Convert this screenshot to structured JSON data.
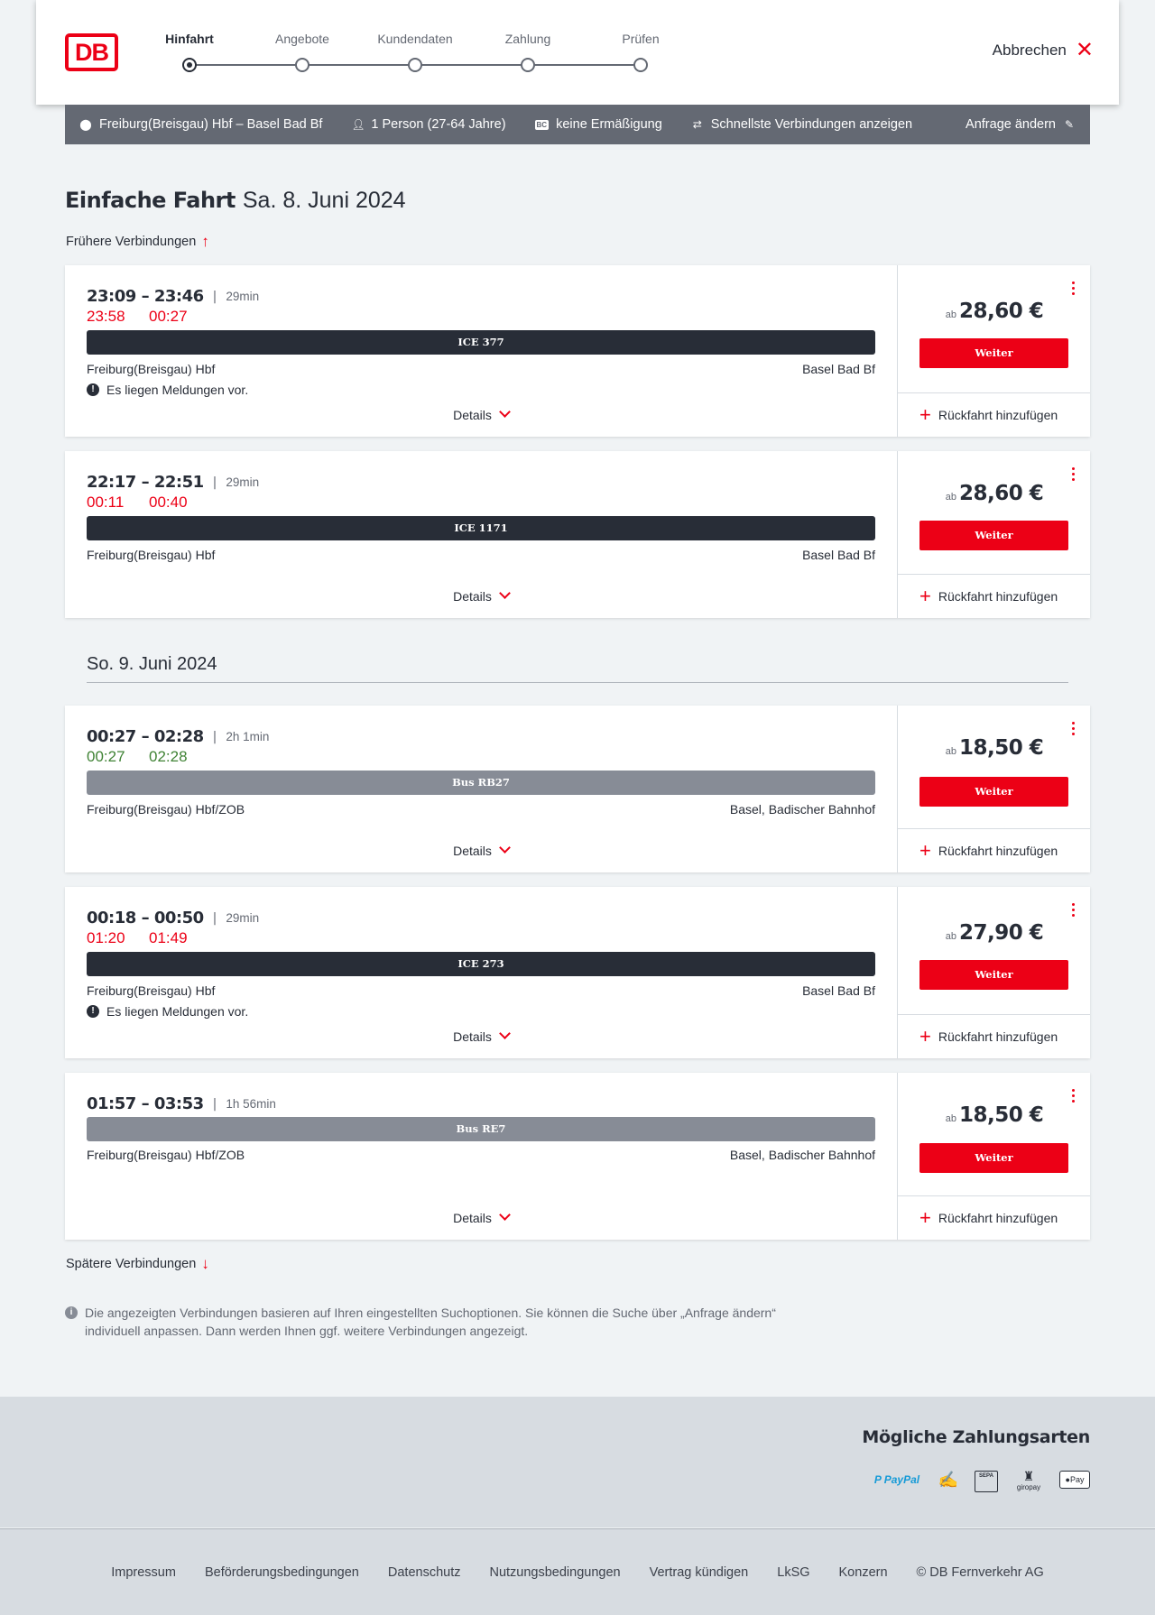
{
  "header": {
    "logo": "DB",
    "steps": [
      {
        "label": "Hinfahrt",
        "active": true
      },
      {
        "label": "Angebote",
        "active": false
      },
      {
        "label": "Kundendaten",
        "active": false
      },
      {
        "label": "Zahlung",
        "active": false
      },
      {
        "label": "Prüfen",
        "active": false
      }
    ],
    "cancel_label": "Abbrechen"
  },
  "query": {
    "route": "Freiburg(Breisgau) Hbf – Basel Bad Bf",
    "persons": "1 Person (27-64 Jahre)",
    "discount_badge": "BC",
    "discount": "keine Ermäßigung",
    "option": "Schnellste Verbindungen anzeigen",
    "edit": "Anfrage ändern"
  },
  "title": {
    "main": "Einfache Fahrt",
    "date": "Sa. 8. Juni 2024"
  },
  "earlier": "Frühere Verbindungen",
  "later": "Spätere Verbindungen",
  "day2": "So. 9. Juni 2024",
  "labels": {
    "details": "Details",
    "ab": "ab",
    "weiter": "Weiter",
    "return": "Rückfahrt hinzufügen",
    "message": "Es liegen Meldungen vor."
  },
  "connections": [
    {
      "times": "23:09 – 23:46",
      "duration": "29min",
      "rt_dep": "23:58",
      "rt_arr": "00:27",
      "rt_status": "red",
      "train": "ICE 377",
      "train_style": "dark",
      "from": "Freiburg(Breisgau) Hbf",
      "to": "Basel Bad Bf",
      "message": true,
      "price": "28,60 €"
    },
    {
      "times": "22:17 – 22:51",
      "duration": "29min",
      "rt_dep": "00:11",
      "rt_arr": "00:40",
      "rt_status": "red",
      "train": "ICE 1171",
      "train_style": "dark",
      "from": "Freiburg(Breisgau) Hbf",
      "to": "Basel Bad Bf",
      "message": false,
      "price": "28,60 €"
    },
    {
      "times": "00:27 – 02:28",
      "duration": "2h 1min",
      "rt_dep": "00:27",
      "rt_arr": "02:28",
      "rt_status": "green",
      "train": "Bus RB27",
      "train_style": "grey",
      "from": "Freiburg(Breisgau) Hbf/ZOB",
      "to": "Basel, Badischer Bahnhof",
      "message": false,
      "price": "18,50 €"
    },
    {
      "times": "00:18 – 00:50",
      "duration": "29min",
      "rt_dep": "01:20",
      "rt_arr": "01:49",
      "rt_status": "red",
      "train": "ICE 273",
      "train_style": "dark",
      "from": "Freiburg(Breisgau) Hbf",
      "to": "Basel Bad Bf",
      "message": true,
      "price": "27,90 €"
    },
    {
      "times": "01:57 – 03:53",
      "duration": "1h 56min",
      "rt_dep": "",
      "rt_arr": "",
      "rt_status": "none",
      "train": "Bus RE7",
      "train_style": "grey",
      "from": "Freiburg(Breisgau) Hbf/ZOB",
      "to": "Basel, Badischer Bahnhof",
      "message": false,
      "price": "18,50 €"
    }
  ],
  "info": "Die angezeigten Verbindungen basieren auf Ihren eingestellten Suchoptionen. Sie können die Suche über „Anfrage ändern“ individuell anpassen. Dann werden Ihnen ggf. weitere Verbindungen angezeigt.",
  "payment": {
    "title": "Mögliche Zahlungsarten",
    "paypal_a": "P PayPal",
    "sepa": "SEPA",
    "giropay": "giropay",
    "applepay": "Pay"
  },
  "footer_links": [
    "Impressum",
    "Beförderungsbedingungen",
    "Datenschutz",
    "Nutzungsbedingungen",
    "Vertrag kündigen",
    "LkSG",
    "Konzern",
    "© DB Fernverkehr AG"
  ],
  "colors": {
    "accent": "#ec0016",
    "delay": "#ec0016",
    "ontime": "#408335",
    "bar": "#646973"
  }
}
